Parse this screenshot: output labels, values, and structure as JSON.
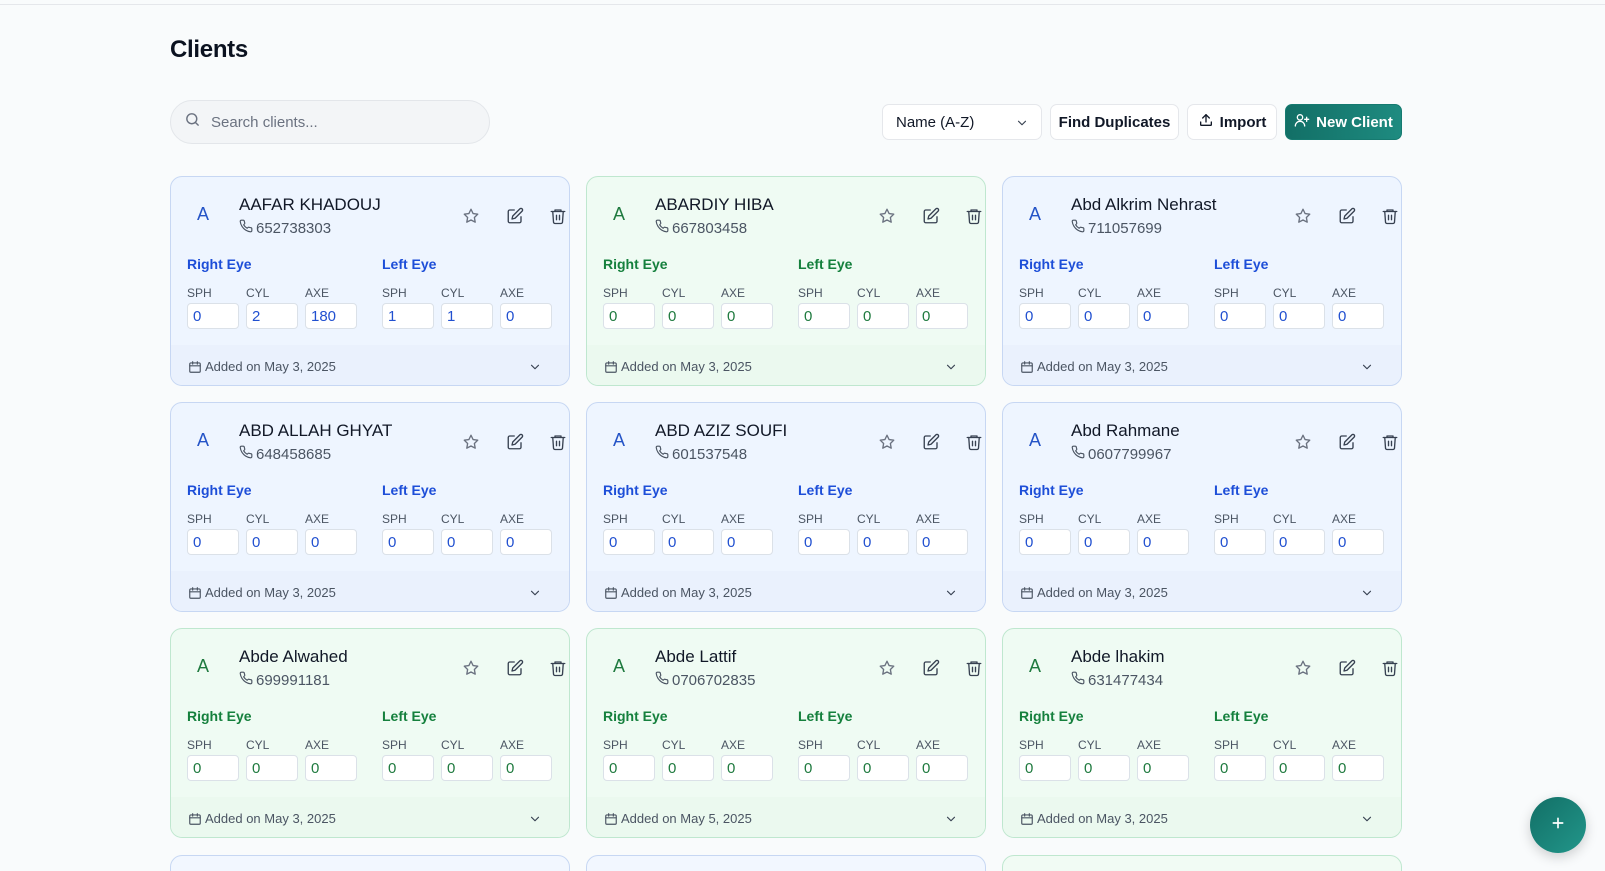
{
  "page": {
    "title": "Clients"
  },
  "toolbar": {
    "search_placeholder": "Search clients...",
    "sort_value": "Name (A-Z)",
    "find_duplicates": "Find Duplicates",
    "import": "Import",
    "new_client": "New Client"
  },
  "labels": {
    "right_eye": "Right Eye",
    "left_eye": "Left Eye",
    "sph": "SPH",
    "cyl": "CYL",
    "axe": "AXE"
  },
  "colors": {
    "accent": "#167a70",
    "blue_card_bg": "#eef5ff",
    "green_card_bg": "#effbf3",
    "blue_text": "#1d4ed8",
    "green_text": "#15803d"
  },
  "clients": [
    {
      "initial": "A",
      "name": "AAFAR KHADOUJ",
      "phone": "652738303",
      "theme": "blue",
      "right": {
        "sph": "0",
        "cyl": "2",
        "axe": "180"
      },
      "left": {
        "sph": "1",
        "cyl": "1",
        "axe": "0"
      },
      "added": "Added on May 3, 2025"
    },
    {
      "initial": "A",
      "name": "ABARDIY HIBA",
      "phone": "667803458",
      "theme": "green",
      "right": {
        "sph": "0",
        "cyl": "0",
        "axe": "0"
      },
      "left": {
        "sph": "0",
        "cyl": "0",
        "axe": "0"
      },
      "added": "Added on May 3, 2025"
    },
    {
      "initial": "A",
      "name": "Abd Alkrim Nehrast",
      "phone": "711057699",
      "theme": "blue",
      "right": {
        "sph": "0",
        "cyl": "0",
        "axe": "0"
      },
      "left": {
        "sph": "0",
        "cyl": "0",
        "axe": "0"
      },
      "added": "Added on May 3, 2025"
    },
    {
      "initial": "A",
      "name": "ABD ALLAH GHYAT",
      "phone": "648458685",
      "theme": "blue",
      "right": {
        "sph": "0",
        "cyl": "0",
        "axe": "0"
      },
      "left": {
        "sph": "0",
        "cyl": "0",
        "axe": "0"
      },
      "added": "Added on May 3, 2025"
    },
    {
      "initial": "A",
      "name": "ABD AZIZ SOUFI",
      "phone": "601537548",
      "theme": "blue",
      "right": {
        "sph": "0",
        "cyl": "0",
        "axe": "0"
      },
      "left": {
        "sph": "0",
        "cyl": "0",
        "axe": "0"
      },
      "added": "Added on May 3, 2025"
    },
    {
      "initial": "A",
      "name": "Abd Rahmane",
      "phone": "0607799967",
      "theme": "blue",
      "right": {
        "sph": "0",
        "cyl": "0",
        "axe": "0"
      },
      "left": {
        "sph": "0",
        "cyl": "0",
        "axe": "0"
      },
      "added": "Added on May 3, 2025"
    },
    {
      "initial": "A",
      "name": "Abde Alwahed",
      "phone": "699991181",
      "theme": "green",
      "right": {
        "sph": "0",
        "cyl": "0",
        "axe": "0"
      },
      "left": {
        "sph": "0",
        "cyl": "0",
        "axe": "0"
      },
      "added": "Added on May 3, 2025"
    },
    {
      "initial": "A",
      "name": "Abde Lattif",
      "phone": "0706702835",
      "theme": "green",
      "right": {
        "sph": "0",
        "cyl": "0",
        "axe": "0"
      },
      "left": {
        "sph": "0",
        "cyl": "0",
        "axe": "0"
      },
      "added": "Added on May 5, 2025"
    },
    {
      "initial": "A",
      "name": "Abde lhakim",
      "phone": "631477434",
      "theme": "green",
      "right": {
        "sph": "0",
        "cyl": "0",
        "axe": "0"
      },
      "left": {
        "sph": "0",
        "cyl": "0",
        "axe": "0"
      },
      "added": "Added on May 3, 2025"
    }
  ],
  "peek_cards": [
    {
      "theme": "blue"
    },
    {
      "theme": "blue"
    },
    {
      "theme": "green"
    }
  ]
}
